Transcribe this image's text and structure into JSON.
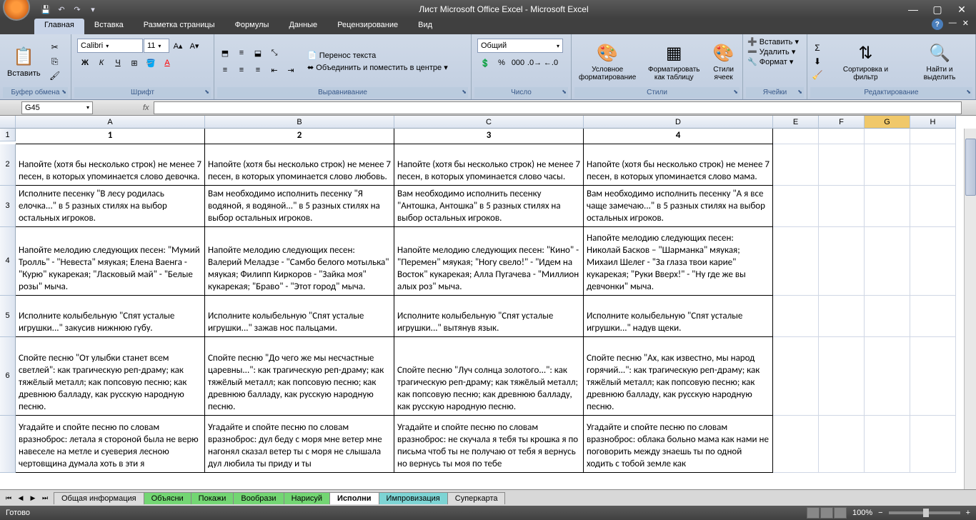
{
  "title": "Лист Microsoft Office Excel - Microsoft Excel",
  "tabs": [
    "Главная",
    "Вставка",
    "Разметка страницы",
    "Формулы",
    "Данные",
    "Рецензирование",
    "Вид"
  ],
  "ribbon": {
    "clipboard": {
      "label": "Буфер обмена",
      "paste": "Вставить"
    },
    "font": {
      "label": "Шрифт",
      "name": "Calibri",
      "size": "11"
    },
    "align": {
      "label": "Выравнивание",
      "wrap": "Перенос текста",
      "merge": "Объединить и поместить в центре"
    },
    "number": {
      "label": "Число",
      "format": "Общий"
    },
    "styles": {
      "label": "Стили",
      "cond": "Условное форматирование",
      "table": "Форматировать как таблицу",
      "cell": "Стили ячеек"
    },
    "cells": {
      "label": "Ячейки",
      "insert": "Вставить",
      "delete": "Удалить",
      "format": "Формат"
    },
    "edit": {
      "label": "Редактирование",
      "sort": "Сортировка и фильтр",
      "find": "Найти и выделить"
    }
  },
  "namebox": "G45",
  "cols": [
    "A",
    "B",
    "C",
    "D",
    "E",
    "F",
    "G",
    "H"
  ],
  "rows": [
    "1",
    "2",
    "3",
    "4",
    "5",
    "6"
  ],
  "hdrs": {
    "A": "1",
    "B": "2",
    "C": "3",
    "D": "4"
  },
  "data": {
    "r2": {
      "A": "Напойте (хотя бы несколько строк) не менее 7 песен, в которых упоминается слово девочка.",
      "B": "Напойте (хотя бы несколько строк) не менее 7 песен, в которых упоминается слово любовь.",
      "C": "Напойте (хотя бы несколько строк) не менее 7 песен, в которых упоминается слово часы.",
      "D": "Напойте (хотя бы несколько строк) не менее 7 песен, в которых упоминается слово мама."
    },
    "r3": {
      "A": "Исполните песенку \"В лесу родилась елочка...\" в 5 разных стилях на выбор остальных игроков.",
      "B": "Вам необходимо исполнить песенку \"Я водяной, я водяной...\" в 5 разных стилях на выбор остальных игроков.",
      "C": "Вам необходимо исполнить песенку \"Антошка, Антошка\" в 5 разных стилях на выбор остальных игроков.",
      "D": "Вам необходимо исполнить песенку \"А я все чаще замечаю...\" в 5 разных стилях на выбор остальных игроков."
    },
    "r4": {
      "A": "Напойте мелодию следующих песен: \"Мумий Тролль\" - \"Невеста\" мяукая; Елена Ваенга - \"Курю\" кукарекая; \"Ласковый май\" - \"Белые розы\" мыча.",
      "B": "Напойте мелодию следующих песен: Валерий Меладзе - \"Самбо белого мотылька\" мяукая; Филипп Киркоров - \"Зайка моя\" кукарекая; \"Браво\" - \"Этот город\" мыча.",
      "C": "Напойте мелодию следующих песен: \"Кино\" - \"Перемен\" мяукая; \"Ногу свело!\" - \"Идем на Восток\" кукарекая; Алла Пугачева - \"Миллион алых роз\" мыча.",
      "D": "Напойте мелодию следующих песен: Николай Басков – \"Шарманка\" мяукая; Михаил Шелег - \"За глаза твои карие\" кукарекая; \"Руки Вверх!\" - \"Ну где же вы девчонки\" мыча."
    },
    "r5": {
      "A": "Исполните колыбельную \"Спят усталые игрушки...\" закусив нижнюю губу.",
      "B": "Исполните колыбельную \"Спят усталые игрушки...\" зажав нос пальцами.",
      "C": "Исполните колыбельную \"Спят усталые игрушки...\" вытянув язык.",
      "D": "Исполните колыбельную \"Спят усталые игрушки...\" надув щеки."
    },
    "r6": {
      "A": "Спойте песню \"От улыбки станет всем светлей\": как трагическую реп-драму; как тяжёлый металл; как попсовую песню; как древнюю балладу, как русскую народную песню.",
      "B": "Спойте песню \"До чего же мы несчастные царевны...\": как трагическую реп-драму; как тяжёлый металл; как попсовую песню; как древнюю балладу, как русскую народную песню.",
      "C": "Спойте песню \"Луч солнца золотого...\": как трагическую реп-драму; как тяжёлый металл; как попсовую песню; как древнюю балладу, как русскую народную песню.",
      "D": "Спойте песню \"Ах, как известно, мы народ горячий...\": как трагическую реп-драму; как тяжёлый металл; как попсовую песню; как древнюю балладу, как русскую народную песню."
    },
    "r7": {
      "A": "Угадайте и спойте песню по словам вразноброс: летала я стороной была не верю навеселе на метле и суеверия лесною чертовщина думала хоть в эти я",
      "B": "Угадайте и спойте песню по словам вразноброс: дул беду с моря мне ветер мне нагонял сказал ветер ты с моря не слышала дул любила ты приду и ты",
      "C": "Угадайте и спойте песню по словам вразноброс: не скучала я тебя ты крошка я по письма чтоб ты не получаю от тебя я вернусь но вернусь ты моя по тебе",
      "D": "Угадайте и спойте песню по словам вразноброс: облака больно мама как нами не поговорить между знаешь ты по одной ходить с тобой земле как"
    }
  },
  "sheets": [
    "Общая информация",
    "Объясни",
    "Покажи",
    "Вообрази",
    "Нарисуй",
    "Исполни",
    "Импровизация",
    "Суперкарта"
  ],
  "status": "Готово",
  "zoom": "100%"
}
